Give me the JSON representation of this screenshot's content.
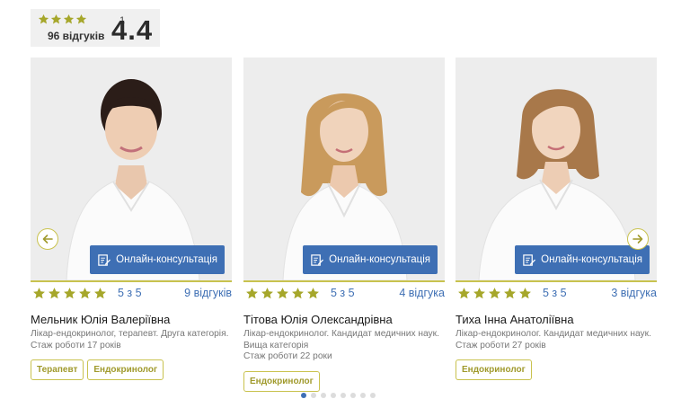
{
  "summary": {
    "stars": 4,
    "stars_count": "1",
    "reviews": "96 відгуків",
    "score": "4.4"
  },
  "colors": {
    "accent_blue": "#3e6fb4",
    "star_gold": "#a6a72b",
    "tag_border": "#c9c24e"
  },
  "doctors": [
    {
      "name": "Мельник Юлія Валеріївна",
      "description_lines": [
        "Лікар-ендокринолог, терапевт. Друга категорія.",
        "Стаж роботи 17 років"
      ],
      "rating_stars": 5,
      "rating_text": "5 з 5",
      "review_count": "9 відгуків",
      "consult_label": "Онлайн-консультація",
      "tags": [
        "Терапевт",
        "Ендокринолог"
      ],
      "hair_color": "#2b1d18"
    },
    {
      "name": "Тітова Юлія Олександрівна",
      "description_lines": [
        "Лікар-ендокринолог. Кандидат медичних наук.",
        "Вища категорія",
        "Стаж роботи 22 роки"
      ],
      "rating_stars": 5,
      "rating_text": "5 з 5",
      "review_count": "4 відгука",
      "consult_label": "Онлайн-консультація",
      "tags": [
        "Ендокринолог"
      ],
      "hair_color": "#c99a5c"
    },
    {
      "name": "Тиха Інна Анатоліївна",
      "description_lines": [
        "Лікар-ендокринолог. Кандидат медичних наук.",
        "Стаж роботи 27 років"
      ],
      "rating_stars": 5,
      "rating_text": "5 з 5",
      "review_count": "3 відгука",
      "consult_label": "Онлайн-консультація",
      "tags": [
        "Ендокринолог"
      ],
      "hair_color": "#a8784a"
    }
  ],
  "pagination": {
    "total": 8,
    "active": 0
  },
  "icons": {
    "prev": "arrow-left-icon",
    "next": "arrow-right-icon",
    "consult": "edit-document-icon",
    "star": "star-icon"
  }
}
